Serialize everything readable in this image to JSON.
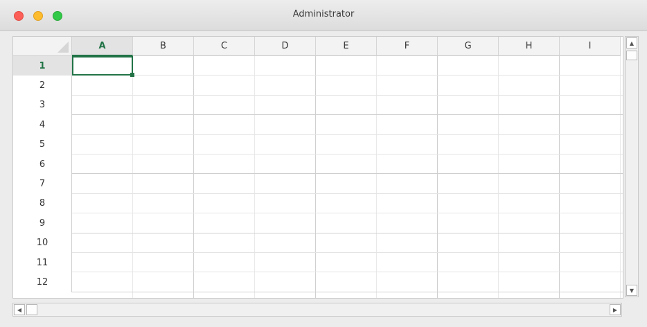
{
  "window": {
    "title": "Administrator"
  },
  "sheet": {
    "columns": [
      "A",
      "B",
      "C",
      "D",
      "E",
      "F",
      "G",
      "H",
      "I"
    ],
    "rows": [
      "1",
      "2",
      "3",
      "4",
      "5",
      "6",
      "7",
      "8",
      "9",
      "10",
      "11",
      "12"
    ],
    "active_cell": "A1",
    "accent_color": "#217346"
  },
  "icons": {
    "scroll_up": "chevron-up-icon",
    "scroll_down": "chevron-down-icon",
    "scroll_left": "chevron-left-icon",
    "scroll_right": "chevron-right-icon"
  }
}
